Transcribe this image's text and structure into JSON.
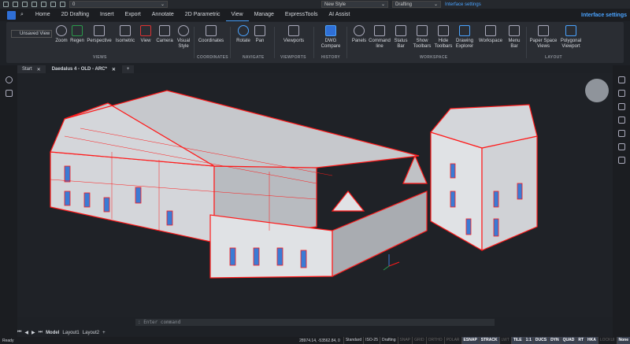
{
  "quick_access": {
    "layer_value": "0",
    "style_value": "New Style",
    "workspace_value": "Drafting",
    "interface_settings": "Interface settings"
  },
  "menu": {
    "tabs": [
      "Home",
      "2D Drafting",
      "Insert",
      "Export",
      "Annotate",
      "2D Parametric",
      "View",
      "Manage",
      "ExpressTools",
      "AI Assist"
    ],
    "active": "View",
    "interface_settings": "Interface settings"
  },
  "ribbon": {
    "unsaved_view": "Unsaved View",
    "buttons": [
      "Zoom",
      "Regen",
      "Perspective",
      "Isometric",
      "View",
      "Camera",
      "Visual Style",
      "Coordinates",
      "Rotate",
      "Pan",
      "Viewports",
      "DWG Compare",
      "Panels",
      "Command line",
      "Status Bar",
      "Show Toolbars",
      "Hide Toolbars",
      "Drawing Explorer",
      "Workspace",
      "Menu Bar",
      "Paper Space Views",
      "Polygonal Viewport"
    ],
    "groups": [
      "VIEWS",
      "COORDINATES",
      "NAVIGATE",
      "VIEWPORTS",
      "HISTORY",
      "WORKSPACE",
      "LAYOUT"
    ]
  },
  "doc_tabs": [
    "Start",
    "Daedalus 4 - OLD - ARC*"
  ],
  "command": {
    "placeholder": ": Enter command"
  },
  "layout_tabs": [
    "Model",
    "Layout1",
    "Layout2"
  ],
  "status": {
    "ready": "Ready",
    "coords": "28974.14, -53562.84, 0",
    "items": [
      "Standard",
      "ISO-25",
      "Drafting",
      "SNAP",
      "GRID",
      "ORTHO",
      "POLAR",
      "ESNAP",
      "STRACK",
      "LWT",
      "TILE",
      "1:1",
      "DUCS",
      "DYN",
      "QUAD",
      "RT",
      "HKA",
      "LOCKUI",
      "None"
    ],
    "on": [
      "Standard",
      "ISO-25",
      "Drafting",
      "ESNAP",
      "STRACK",
      "TILE",
      "1:1",
      "DUCS",
      "DYN",
      "QUAD",
      "RT",
      "HKA",
      "None"
    ]
  },
  "colors": {
    "accent": "#4aa3ff",
    "model_lines": "#ff1a1a",
    "windows": "#3a7bd5"
  }
}
